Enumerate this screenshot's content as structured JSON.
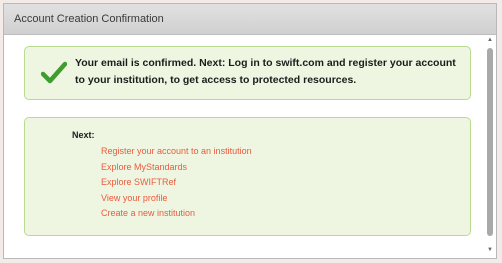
{
  "dialog": {
    "title": "Account Creation Confirmation"
  },
  "confirmation": {
    "icon": "check-icon",
    "message": "Your email is confirmed. Next: Log in to swift.com and register your account to your institution, to get access to protected resources.",
    "accent_color": "#3f9c2f"
  },
  "next": {
    "label": "Next:",
    "links": [
      "Register your account to an institution",
      "Explore MyStandards",
      "Explore SWIFTRef",
      "View your profile",
      "Create a new institution"
    ],
    "link_color": "#ec5a3c"
  },
  "scrollbar": {
    "up_glyph": "▲",
    "down_glyph": "▼"
  }
}
